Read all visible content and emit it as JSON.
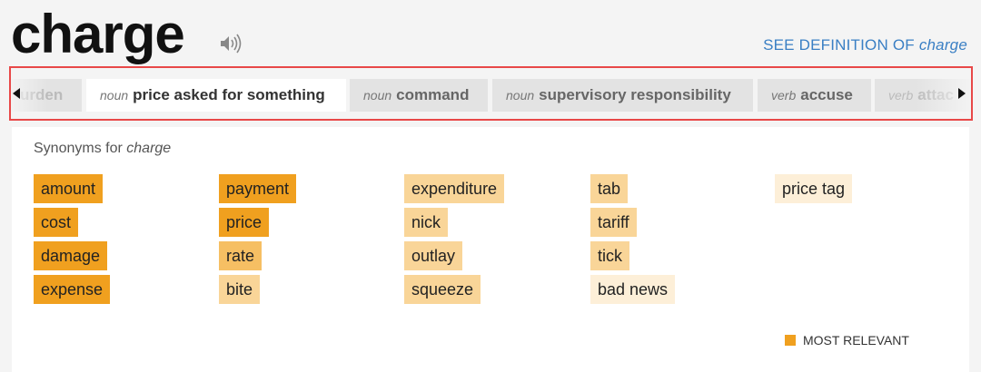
{
  "entry": {
    "word": "charge",
    "see_definition": "SEE DEFINITION OF ",
    "see_definition_word": "charge"
  },
  "tabs": [
    {
      "pos": "",
      "label": "urden"
    },
    {
      "pos": "noun",
      "label": "price asked for something"
    },
    {
      "pos": "noun",
      "label": "command"
    },
    {
      "pos": "noun",
      "label": "supervisory responsibility"
    },
    {
      "pos": "verb",
      "label": "accuse"
    },
    {
      "pos": "verb",
      "label": "attac"
    }
  ],
  "synonyms": {
    "title_prefix": "Synonyms for ",
    "title_word": "charge",
    "columns": [
      [
        "amount",
        "cost",
        "damage",
        "expense"
      ],
      [
        "payment",
        "price",
        "rate",
        "bite"
      ],
      [
        "expenditure",
        "nick",
        "outlay",
        "squeeze"
      ],
      [
        "tab",
        "tariff",
        "tick",
        "bad news"
      ],
      [
        "price tag"
      ]
    ]
  },
  "legend": {
    "label": "MOST RELEVANT"
  },
  "colors": {
    "relevance_1": "#f0a01f",
    "relevance_2": "#f6bf63",
    "relevance_3": "#f9d598",
    "relevance_4": "#fbe4bd",
    "relevance_5": "#fdefd8",
    "link": "#3a7fc4",
    "highlight_border": "#e84848"
  }
}
